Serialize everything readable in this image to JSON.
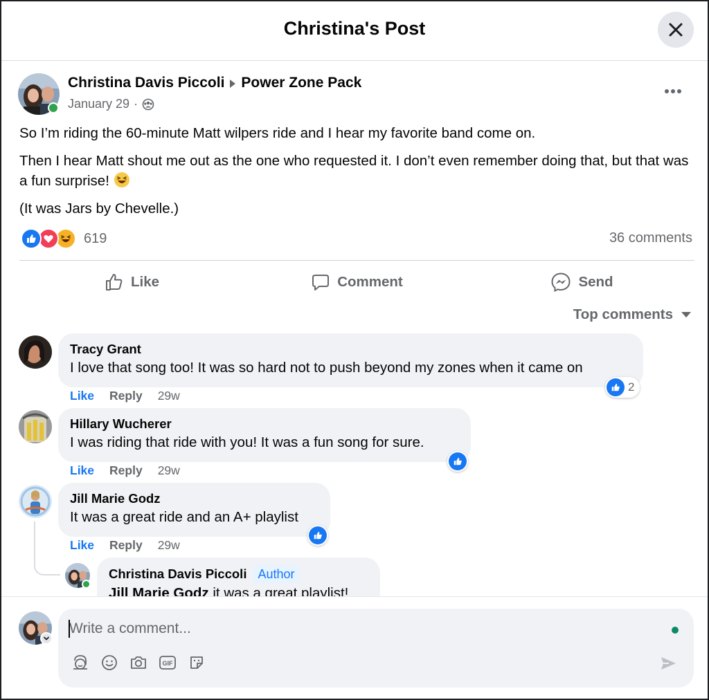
{
  "header": {
    "title": "Christina's Post"
  },
  "post": {
    "author": "Christina Davis Piccoli",
    "group": "Power Zone Pack",
    "date": "January 29",
    "paragraphs": [
      "So I’m riding the 60-minute Matt wilpers ride and I hear my favorite band come on.",
      "Then I hear Matt shout me out as the one who requested it. I don’t even remember doing that, but that was a fun surprise!",
      "(It was Jars by Chevelle.)"
    ],
    "reaction_count": "619",
    "comments_count": "36 comments"
  },
  "actions": {
    "like": "Like",
    "comment": "Comment",
    "send": "Send"
  },
  "sort": {
    "label": "Top comments"
  },
  "comments": [
    {
      "name": "Tracy Grant",
      "text": "I love that song too! It was so hard not to push beyond my zones when it came on",
      "like": "Like",
      "reply": "Reply",
      "time": "29w",
      "reactions": "2"
    },
    {
      "name": "Hillary Wucherer",
      "text": "I was riding that ride with you! It was a fun song for sure.",
      "like": "Like",
      "reply": "Reply",
      "time": "29w"
    },
    {
      "name": "Jill Marie Godz",
      "text": "It was a great ride and an A+ playlist",
      "like": "Like",
      "reply": "Reply",
      "time": "29w"
    }
  ],
  "reply": {
    "name": "Christina Davis Piccoli",
    "badge": "Author",
    "mention": "Jill Marie Godz",
    "text": " it was a great playlist!"
  },
  "composer": {
    "placeholder": "Write a comment..."
  },
  "colors": {
    "accent": "#1877f2",
    "online": "#31a24c",
    "love": "#f33e58",
    "haha": "#f7b125"
  }
}
